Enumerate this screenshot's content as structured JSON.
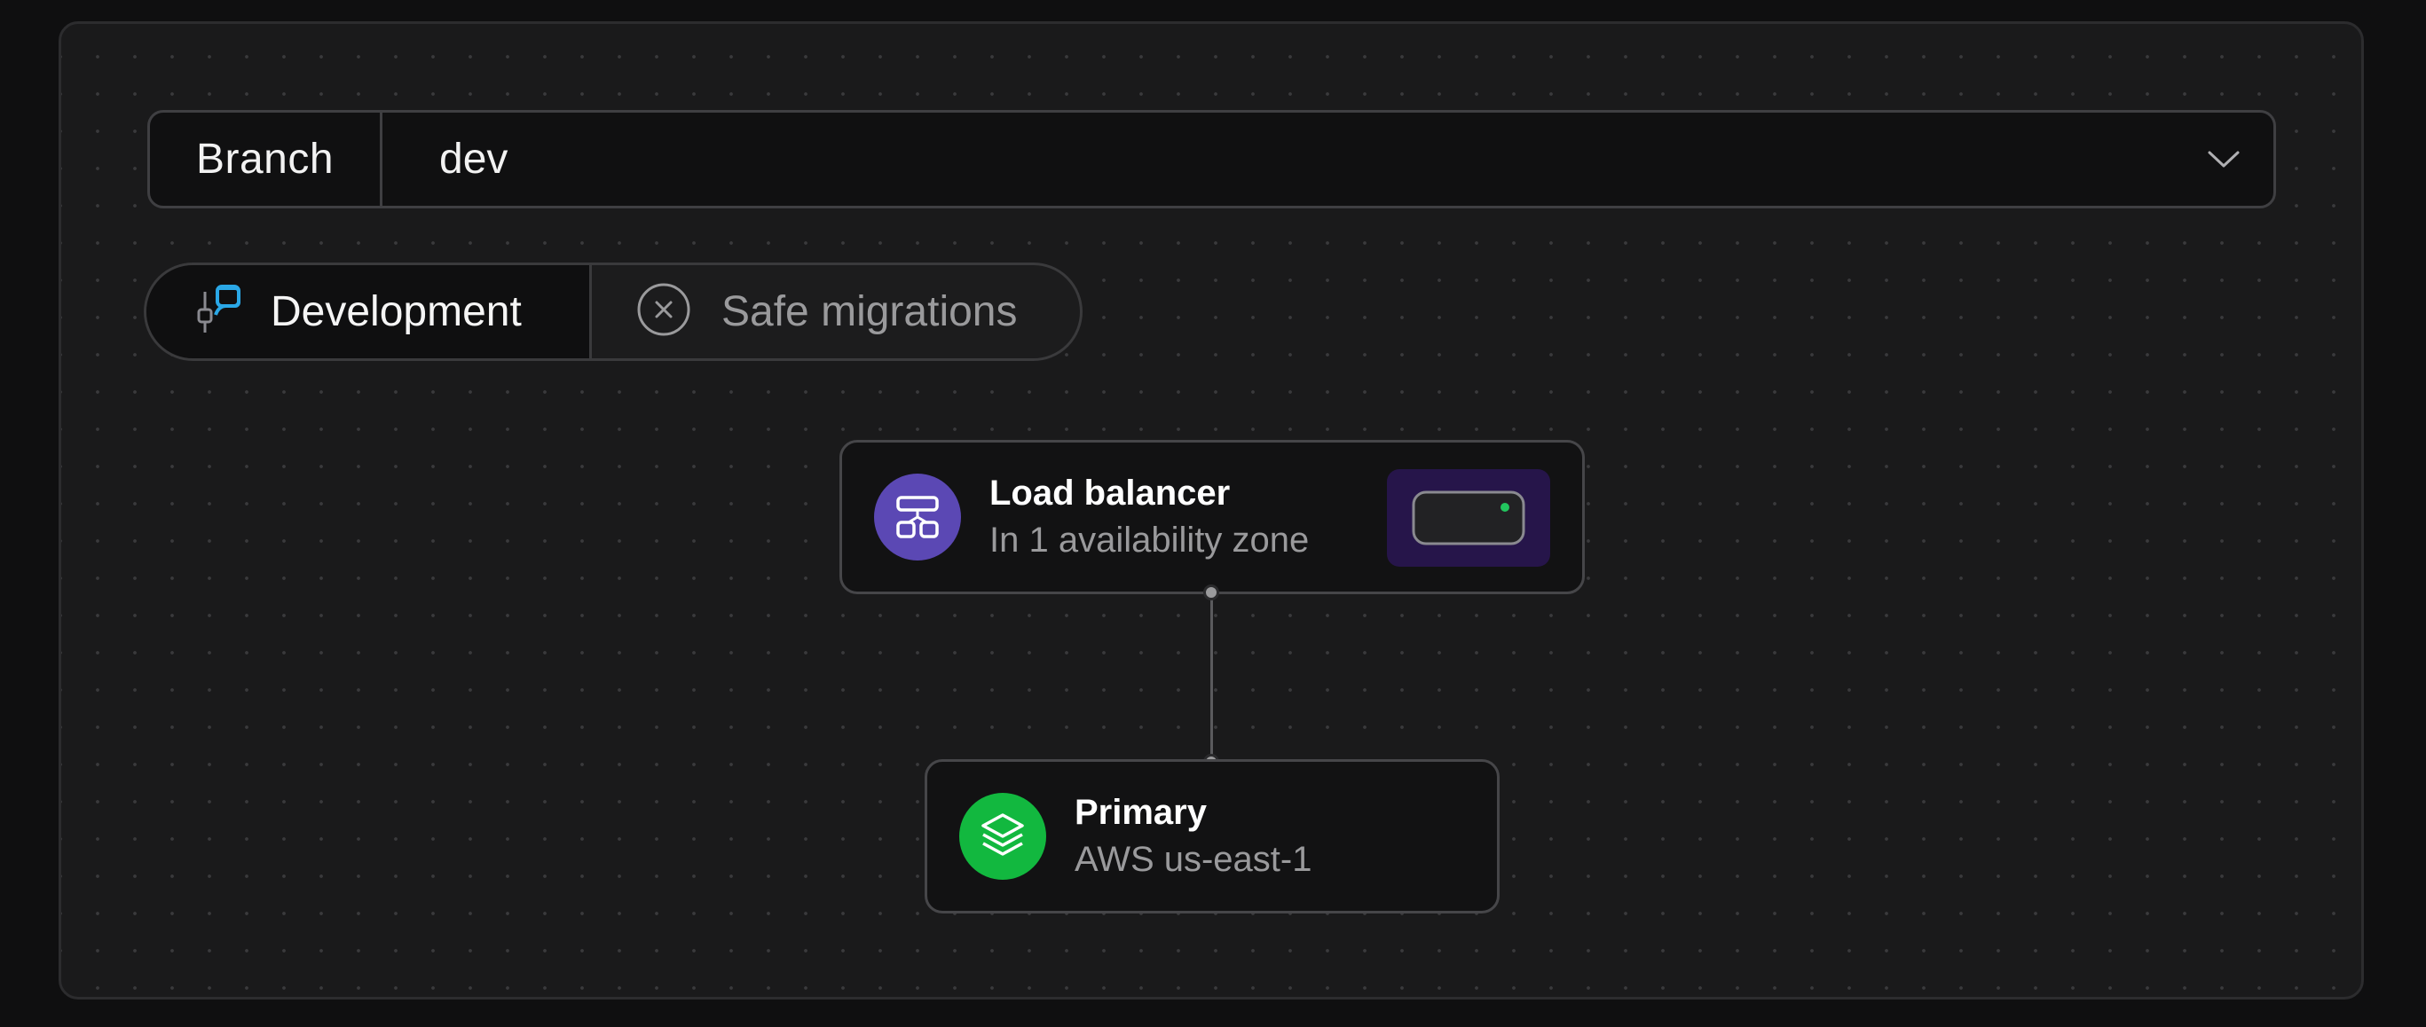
{
  "branch": {
    "label": "Branch",
    "value": "dev"
  },
  "environment": {
    "name": "Development"
  },
  "migrations": {
    "label": "Safe migrations"
  },
  "nodes": {
    "load_balancer": {
      "title": "Load balancer",
      "subtitle": "In 1 availability zone"
    },
    "primary": {
      "title": "Primary",
      "subtitle": "AWS us-east-1"
    }
  },
  "icons": {
    "development": "development-branch-icon",
    "migrations": "close-circle-icon",
    "chevron": "chevron-down-icon",
    "load_balancer": "load-balancer-icon",
    "primary": "layers-icon",
    "status": "status-indicator-icon"
  },
  "colors": {
    "accent_blue": "#2aa7e6",
    "load_balancer_purple": "#5b48b4",
    "primary_green": "#12b83f",
    "status_green": "#22c55e"
  }
}
